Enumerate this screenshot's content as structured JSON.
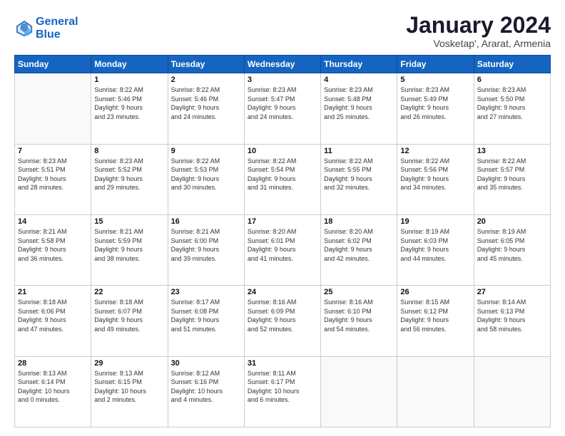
{
  "header": {
    "logo_line1": "General",
    "logo_line2": "Blue",
    "month": "January 2024",
    "location": "Vosketap', Ararat, Armenia"
  },
  "weekdays": [
    "Sunday",
    "Monday",
    "Tuesday",
    "Wednesday",
    "Thursday",
    "Friday",
    "Saturday"
  ],
  "weeks": [
    [
      {
        "day": "",
        "info": ""
      },
      {
        "day": "1",
        "info": "Sunrise: 8:22 AM\nSunset: 5:46 PM\nDaylight: 9 hours\nand 23 minutes."
      },
      {
        "day": "2",
        "info": "Sunrise: 8:22 AM\nSunset: 5:46 PM\nDaylight: 9 hours\nand 24 minutes."
      },
      {
        "day": "3",
        "info": "Sunrise: 8:23 AM\nSunset: 5:47 PM\nDaylight: 9 hours\nand 24 minutes."
      },
      {
        "day": "4",
        "info": "Sunrise: 8:23 AM\nSunset: 5:48 PM\nDaylight: 9 hours\nand 25 minutes."
      },
      {
        "day": "5",
        "info": "Sunrise: 8:23 AM\nSunset: 5:49 PM\nDaylight: 9 hours\nand 26 minutes."
      },
      {
        "day": "6",
        "info": "Sunrise: 8:23 AM\nSunset: 5:50 PM\nDaylight: 9 hours\nand 27 minutes."
      }
    ],
    [
      {
        "day": "7",
        "info": "Sunrise: 8:23 AM\nSunset: 5:51 PM\nDaylight: 9 hours\nand 28 minutes."
      },
      {
        "day": "8",
        "info": "Sunrise: 8:23 AM\nSunset: 5:52 PM\nDaylight: 9 hours\nand 29 minutes."
      },
      {
        "day": "9",
        "info": "Sunrise: 8:22 AM\nSunset: 5:53 PM\nDaylight: 9 hours\nand 30 minutes."
      },
      {
        "day": "10",
        "info": "Sunrise: 8:22 AM\nSunset: 5:54 PM\nDaylight: 9 hours\nand 31 minutes."
      },
      {
        "day": "11",
        "info": "Sunrise: 8:22 AM\nSunset: 5:55 PM\nDaylight: 9 hours\nand 32 minutes."
      },
      {
        "day": "12",
        "info": "Sunrise: 8:22 AM\nSunset: 5:56 PM\nDaylight: 9 hours\nand 34 minutes."
      },
      {
        "day": "13",
        "info": "Sunrise: 8:22 AM\nSunset: 5:57 PM\nDaylight: 9 hours\nand 35 minutes."
      }
    ],
    [
      {
        "day": "14",
        "info": "Sunrise: 8:21 AM\nSunset: 5:58 PM\nDaylight: 9 hours\nand 36 minutes."
      },
      {
        "day": "15",
        "info": "Sunrise: 8:21 AM\nSunset: 5:59 PM\nDaylight: 9 hours\nand 38 minutes."
      },
      {
        "day": "16",
        "info": "Sunrise: 8:21 AM\nSunset: 6:00 PM\nDaylight: 9 hours\nand 39 minutes."
      },
      {
        "day": "17",
        "info": "Sunrise: 8:20 AM\nSunset: 6:01 PM\nDaylight: 9 hours\nand 41 minutes."
      },
      {
        "day": "18",
        "info": "Sunrise: 8:20 AM\nSunset: 6:02 PM\nDaylight: 9 hours\nand 42 minutes."
      },
      {
        "day": "19",
        "info": "Sunrise: 8:19 AM\nSunset: 6:03 PM\nDaylight: 9 hours\nand 44 minutes."
      },
      {
        "day": "20",
        "info": "Sunrise: 8:19 AM\nSunset: 6:05 PM\nDaylight: 9 hours\nand 45 minutes."
      }
    ],
    [
      {
        "day": "21",
        "info": "Sunrise: 8:18 AM\nSunset: 6:06 PM\nDaylight: 9 hours\nand 47 minutes."
      },
      {
        "day": "22",
        "info": "Sunrise: 8:18 AM\nSunset: 6:07 PM\nDaylight: 9 hours\nand 49 minutes."
      },
      {
        "day": "23",
        "info": "Sunrise: 8:17 AM\nSunset: 6:08 PM\nDaylight: 9 hours\nand 51 minutes."
      },
      {
        "day": "24",
        "info": "Sunrise: 8:16 AM\nSunset: 6:09 PM\nDaylight: 9 hours\nand 52 minutes."
      },
      {
        "day": "25",
        "info": "Sunrise: 8:16 AM\nSunset: 6:10 PM\nDaylight: 9 hours\nand 54 minutes."
      },
      {
        "day": "26",
        "info": "Sunrise: 8:15 AM\nSunset: 6:12 PM\nDaylight: 9 hours\nand 56 minutes."
      },
      {
        "day": "27",
        "info": "Sunrise: 8:14 AM\nSunset: 6:13 PM\nDaylight: 9 hours\nand 58 minutes."
      }
    ],
    [
      {
        "day": "28",
        "info": "Sunrise: 8:13 AM\nSunset: 6:14 PM\nDaylight: 10 hours\nand 0 minutes."
      },
      {
        "day": "29",
        "info": "Sunrise: 8:13 AM\nSunset: 6:15 PM\nDaylight: 10 hours\nand 2 minutes."
      },
      {
        "day": "30",
        "info": "Sunrise: 8:12 AM\nSunset: 6:16 PM\nDaylight: 10 hours\nand 4 minutes."
      },
      {
        "day": "31",
        "info": "Sunrise: 8:11 AM\nSunset: 6:17 PM\nDaylight: 10 hours\nand 6 minutes."
      },
      {
        "day": "",
        "info": ""
      },
      {
        "day": "",
        "info": ""
      },
      {
        "day": "",
        "info": ""
      }
    ]
  ]
}
